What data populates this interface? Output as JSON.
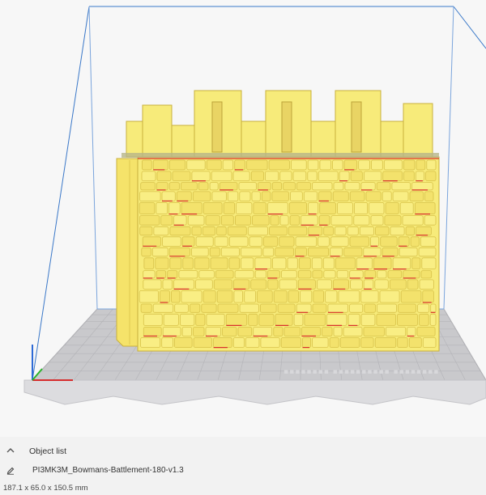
{
  "colors": {
    "model": "#f7eb7a",
    "model_shadow": "#d8c24a",
    "overhang": "#d8302a",
    "build_plate": "#c6c6c9",
    "grid_line": "#b3b3b7",
    "build_volume_edge": "#3a78c8",
    "axis_x": "#d62d2d",
    "axis_y": "#2bb52b",
    "axis_z": "#2d6ad6"
  },
  "icons": {
    "collapse": "chevron-up-icon",
    "edit": "pencil-icon"
  },
  "object_list": {
    "toggle_label": "Object list",
    "file_name": "PI3MK3M_Bowmans-Battlement-180-v1.3",
    "dimensions": "187.1 x 65.0 x 150.5 mm"
  }
}
